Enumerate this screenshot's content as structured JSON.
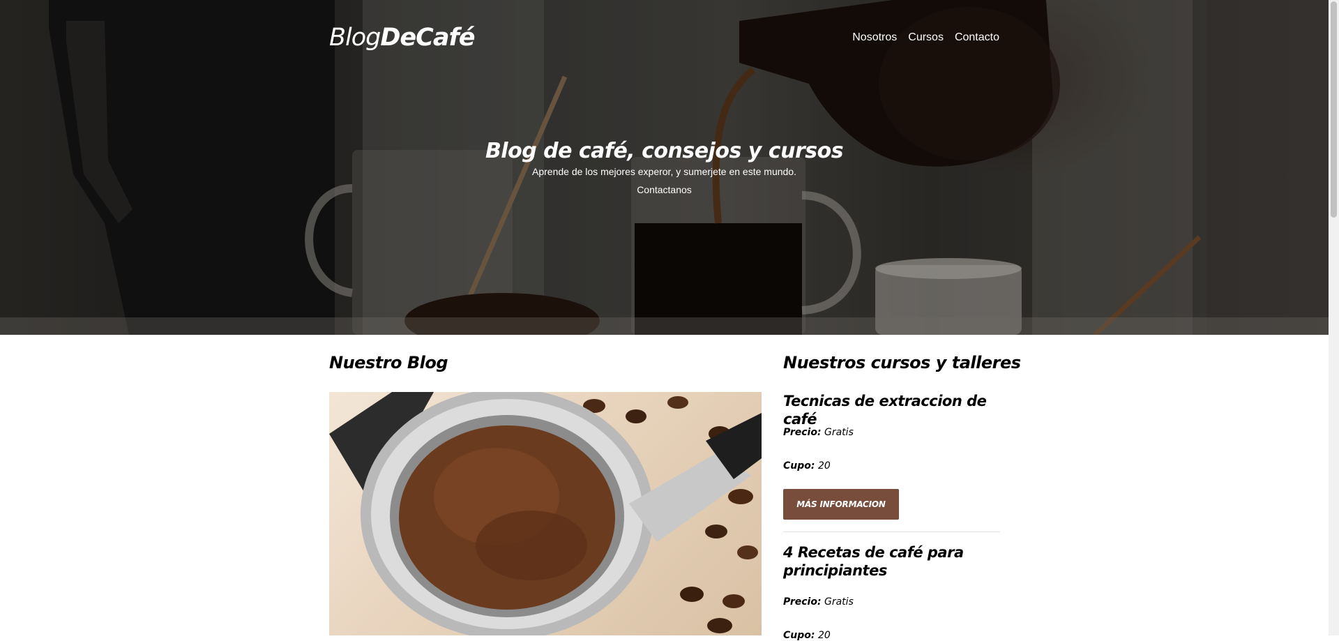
{
  "header": {
    "logo_thin": "Blog",
    "logo_bold": "DeCafé",
    "nav": [
      "Nosotros",
      "Cursos",
      "Contacto"
    ]
  },
  "hero": {
    "title": "Blog de café, consejos y cursos",
    "subtitle": "Aprende de los mejores experor, y sumerjete en este mundo.",
    "cta": "Contactanos"
  },
  "blog": {
    "heading": "Nuestro Blog"
  },
  "courses": {
    "heading": "Nuestros cursos y talleres",
    "price_label": "Precio:",
    "spots_label": "Cupo:",
    "items": [
      {
        "title": "Tecnicas de extraccion de café",
        "price": "Gratis",
        "spots": "20",
        "button": "MÁS INFORMACION"
      },
      {
        "title": "4 Recetas de café para principiantes",
        "price": "Gratis",
        "spots": "20"
      }
    ]
  },
  "colors": {
    "accent": "#784d3c",
    "divider": "#e2e2e2"
  }
}
